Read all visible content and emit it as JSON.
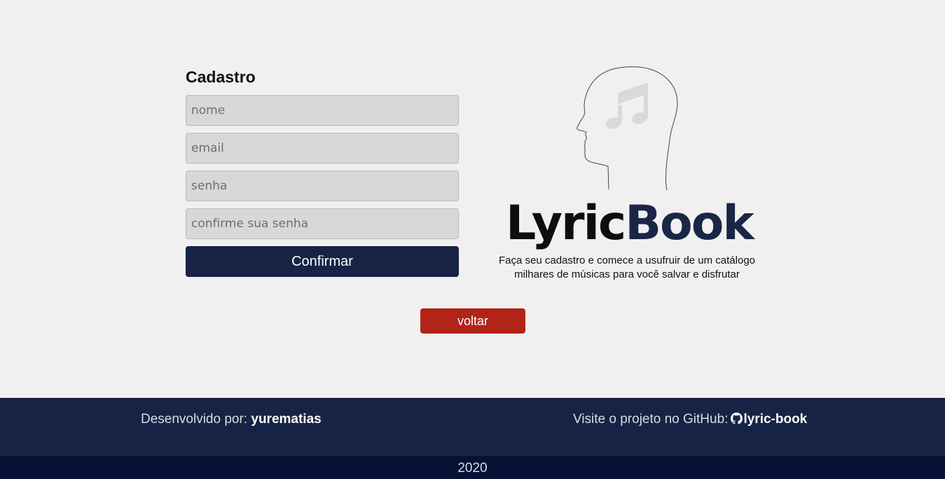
{
  "form": {
    "title": "Cadastro",
    "name_placeholder": "nome",
    "email_placeholder": "email",
    "password_placeholder": "senha",
    "confirm_password_placeholder": "confirme sua senha",
    "confirm_label": "Confirmar"
  },
  "brand": {
    "name_part1": "Lyric",
    "name_part2": "Book",
    "tagline_line1": "Faça seu cadastro e comece a usufruir de um catálogo",
    "tagline_line2": "milhares de músicas para você salvar e disfrutar",
    "illustration_icon": "head-music-note-icon"
  },
  "back_label": "voltar",
  "footer": {
    "developed_by_label": "Desenvolvido por:",
    "developer": "yurematias",
    "github_label": "Visite o projeto no GitHub:",
    "github_icon": "github-icon",
    "repo": "lyric-book",
    "year": "2020"
  },
  "colors": {
    "background": "#f0f0f0",
    "navy": "#172345",
    "dark_navy": "#061236",
    "red": "#b22418",
    "input_bg": "#d8d8d8"
  }
}
